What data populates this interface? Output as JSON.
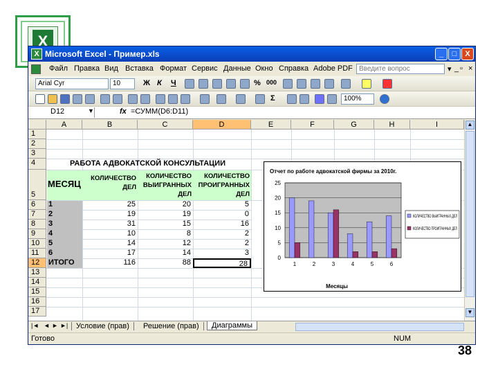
{
  "slide": {
    "page_number": "38"
  },
  "window": {
    "title": "Microsoft Excel - Пример.xls",
    "help_placeholder": "Введите вопрос",
    "controls": {
      "minimize": "_",
      "maximize": "□",
      "close": "X"
    }
  },
  "menu": [
    "Файл",
    "Правка",
    "Вид",
    "Вставка",
    "Формат",
    "Сервис",
    "Данные",
    "Окно",
    "Справка",
    "Adobe PDF"
  ],
  "format_toolbar": {
    "font": "Arial Cyr",
    "size": "10",
    "bold": "Ж",
    "italic": "К",
    "underline": "Ч",
    "percent": "%",
    "thousands": "000"
  },
  "standard_toolbar": {
    "zoom": "100%",
    "sum": "Σ"
  },
  "formula_bar": {
    "name_box": "D12",
    "fx": "fx",
    "formula": "=СУММ(D6:D11)"
  },
  "columns": [
    "A",
    "B",
    "C",
    "D",
    "E",
    "F",
    "G",
    "H",
    "I"
  ],
  "rows": [
    "1",
    "2",
    "3",
    "4",
    "5",
    "6",
    "7",
    "8",
    "9",
    "10",
    "11",
    "12",
    "13",
    "14",
    "15",
    "16",
    "17"
  ],
  "table": {
    "title": "РАБОТА АДВОКАТСКОЙ КОНСУЛЬТАЦИИ",
    "headers": {
      "month": "МЕСЯЦ",
      "total": "КОЛИЧЕСТВО ДЕЛ",
      "won": "КОЛИЧЕСТВО ВЫИГРАННЫХ ДЕЛ",
      "lost": "КОЛИЧЕСТВО ПРОИГРАННЫХ ДЕЛ"
    },
    "rows": [
      {
        "month": "1",
        "total": "25",
        "won": "20",
        "lost": "5"
      },
      {
        "month": "2",
        "total": "19",
        "won": "19",
        "lost": "0"
      },
      {
        "month": "3",
        "total": "31",
        "won": "15",
        "lost": "16"
      },
      {
        "month": "4",
        "total": "10",
        "won": "8",
        "lost": "2"
      },
      {
        "month": "5",
        "total": "14",
        "won": "12",
        "lost": "2"
      },
      {
        "month": "6",
        "total": "17",
        "won": "14",
        "lost": "3"
      }
    ],
    "total_row": {
      "label": "ИТОГО",
      "total": "116",
      "won": "88",
      "lost": "28"
    }
  },
  "chart_data": {
    "type": "bar",
    "title": "Отчет по работе адвокатской фирмы за 2010г.",
    "categories": [
      "1",
      "2",
      "3",
      "4",
      "5",
      "6"
    ],
    "series": [
      {
        "name": "КОЛИЧЕСТВО ВЫИГРАННЫХ ДЕЛ",
        "values": [
          20,
          19,
          15,
          8,
          12,
          14
        ],
        "color": "#9999ff"
      },
      {
        "name": "КОЛИЧЕСТВО ПРОИГРАННЫХ ДЕЛ",
        "values": [
          5,
          0,
          16,
          2,
          2,
          3
        ],
        "color": "#993366"
      }
    ],
    "yticks": [
      "0",
      "5",
      "10",
      "15",
      "20",
      "25"
    ],
    "ylim": [
      0,
      25
    ],
    "xlabel": "Месяцы",
    "ylabel": "",
    "plot_background": "#c0c0c0",
    "legend": "right",
    "grid": true
  },
  "sheet_tabs": [
    "Условие (прав)",
    "Решение (прав)",
    "Диаграммы"
  ],
  "sheet_nav": [
    "|◄",
    "◄",
    "►",
    "►|"
  ],
  "status": {
    "left": "Готово",
    "right": "NUM"
  }
}
